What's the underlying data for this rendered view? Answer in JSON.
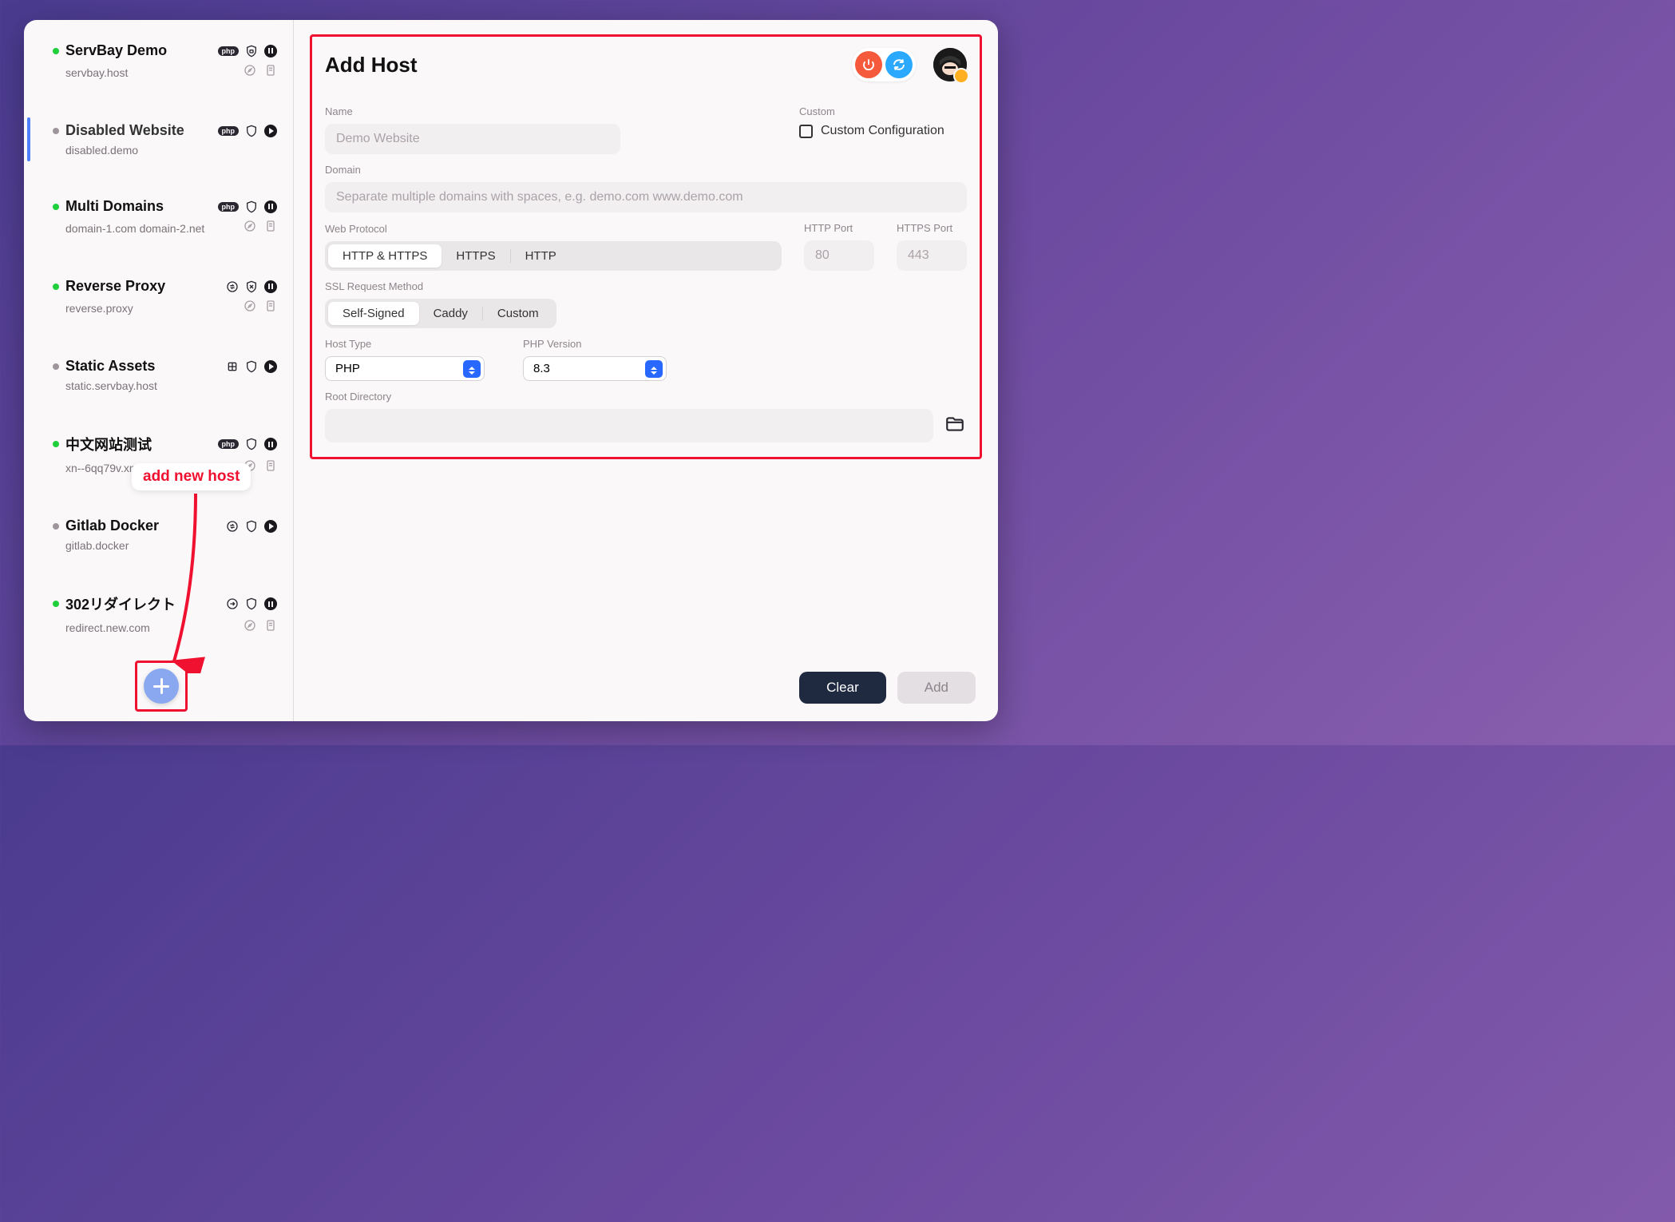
{
  "sidebar": {
    "hosts": [
      {
        "name": "ServBay Demo",
        "domain": "servbay.host",
        "status": "green",
        "badge": "php",
        "icon2": "shield-lock",
        "icon3": "pause",
        "sub1": "compass",
        "sub2": "doc"
      },
      {
        "name": "Disabled Website",
        "domain": "disabled.demo",
        "status": "gray",
        "badge": "php",
        "icon2": "shield",
        "icon3": "play",
        "selected": true
      },
      {
        "name": "Multi Domains",
        "domain": "domain-1.com domain-2.net",
        "status": "green",
        "badge": "php",
        "icon2": "shield",
        "icon3": "pause",
        "sub1": "compass",
        "sub2": "doc"
      },
      {
        "name": "Reverse Proxy",
        "domain": "reverse.proxy",
        "status": "green",
        "badge": "swap",
        "icon2": "shield-x",
        "icon3": "pause",
        "sub1": "compass",
        "sub2": "doc"
      },
      {
        "name": "Static Assets",
        "domain": "static.servbay.host",
        "status": "gray",
        "badge": "grid",
        "icon2": "shield",
        "icon3": "play"
      },
      {
        "name": "中文网站测试",
        "domain": "xn--6qq79v.xn--fiqs8s",
        "status": "green",
        "badge": "php",
        "icon2": "shield",
        "icon3": "pause",
        "sub1": "compass",
        "sub2": "doc"
      },
      {
        "name": "Gitlab Docker",
        "domain": "gitlab.docker",
        "status": "gray",
        "badge": "swap",
        "icon2": "shield",
        "icon3": "play"
      },
      {
        "name": "302リダイレクト",
        "domain": "redirect.new.com",
        "status": "green",
        "badge": "redirect",
        "icon2": "shield",
        "icon3": "pause",
        "sub1": "compass",
        "sub2": "doc"
      }
    ]
  },
  "main": {
    "title": "Add Host",
    "labels": {
      "name": "Name",
      "custom": "Custom",
      "custom_config": "Custom Configuration",
      "domain": "Domain",
      "web_protocol": "Web Protocol",
      "http_port": "HTTP Port",
      "https_port": "HTTPS Port",
      "ssl_method": "SSL Request Method",
      "host_type": "Host Type",
      "php_version": "PHP Version",
      "root_dir": "Root Directory"
    },
    "placeholders": {
      "name": "Demo Website",
      "domain": "Separate multiple domains with spaces, e.g. demo.com www.demo.com",
      "http_port": "80",
      "https_port": "443"
    },
    "protocol_opts": [
      "HTTP & HTTPS",
      "HTTPS",
      "HTTP"
    ],
    "ssl_opts": [
      "Self-Signed",
      "Caddy",
      "Custom"
    ],
    "host_type_value": "PHP",
    "php_version_value": "8.3"
  },
  "footer": {
    "clear": "Clear",
    "add": "Add"
  },
  "annotation": "add new host",
  "colors": {
    "accent_highlight": "#f01030",
    "primary": "#2968ff",
    "power": "#f65a3c",
    "reload": "#2aa9ff"
  }
}
